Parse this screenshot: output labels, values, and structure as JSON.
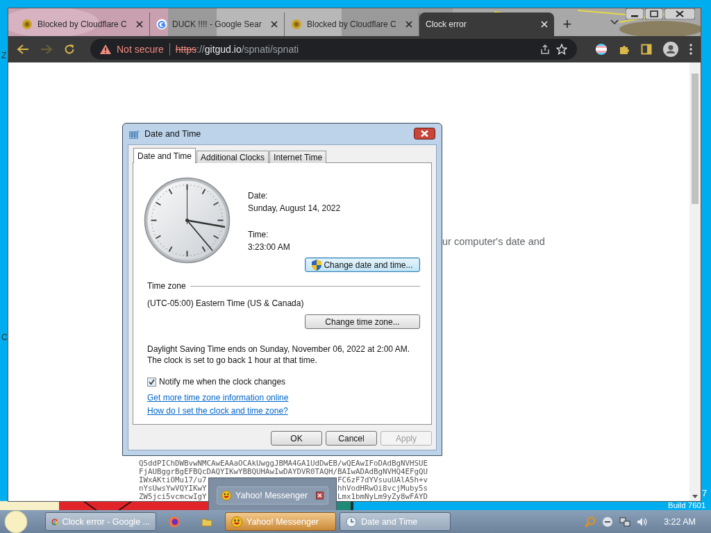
{
  "desktop": {
    "labels": [
      {
        "text": "Z"
      },
      {
        "text": "C"
      },
      {
        "text": "7"
      },
      {
        "text": "Build 7601"
      }
    ]
  },
  "browser": {
    "tabs": [
      {
        "title": "Blocked by Cloudflare C",
        "kind": "site",
        "selected": false
      },
      {
        "title": "DUCK !!!! - Google Sear",
        "kind": "search",
        "selected": false
      },
      {
        "title": "Blocked by Cloudflare C",
        "kind": "site",
        "selected": false
      },
      {
        "title": "Clock error",
        "kind": "blank",
        "selected": true
      }
    ],
    "new_tab": "+",
    "security_warning": "Not secure",
    "url": {
      "scheme": "https",
      "separator": "://",
      "host": "gitgud.io",
      "path": "/spnati/spnati"
    },
    "page": {
      "message": "ur computer's date and",
      "code_lines": [
        {
          "parts": [
            "Q5ddPIChDWBvwNMCAwEAAaOCAkUwggJBMA4GA1UdDwEB/wQEAwIFoDAdBgNVHSUE"
          ]
        },
        {
          "parts": [
            "FjAUBggrBgEFBQcDAQYIKwYBBQUHAwIwDAYDVR0TAQH/BAIwADAdBgNVHQ4EFgQU"
          ]
        },
        {
          "parts": [
            "IWxAKtiOMu17/u7",
            "FC6zF7dYVsuuUAlA5h+v"
          ]
        },
        {
          "parts": [
            "nYsUwsYwVQYIKwY",
            "hhVodHRwOi8vcjMuby5s"
          ]
        },
        {
          "parts": [
            "ZW5jci5vcmcwIgY",
            "Lmx1bmNyLm9yZy8wFAYD"
          ]
        }
      ]
    }
  },
  "dialog": {
    "title": "Date and Time",
    "tabs": [
      {
        "label": "Date and Time",
        "selected": true
      },
      {
        "label": "Additional Clocks",
        "selected": false
      },
      {
        "label": "Internet Time",
        "selected": false
      }
    ],
    "date_label": "Date:",
    "date": "Sunday, August 14, 2022",
    "time_label": "Time:",
    "time": "3:23:00 AM",
    "change_datetime_button": "Change date and time...",
    "time_zone_heading": "Time zone",
    "time_zone": "(UTC-05:00) Eastern Time (US & Canada)",
    "change_zone_button": "Change time zone...",
    "dst_note": "Daylight Saving Time ends on Sunday, November 06, 2022 at 2:00 AM. The clock is set to go back 1 hour at that time.",
    "notify": {
      "label": "Notify me when the clock changes",
      "checked": true
    },
    "links": [
      "Get more time zone information online",
      "How do I set the clock and time zone?"
    ],
    "buttons": [
      {
        "label": "OK",
        "disabled": false
      },
      {
        "label": "Cancel",
        "disabled": false
      },
      {
        "label": "Apply",
        "disabled": true
      }
    ]
  },
  "notification": {
    "title": "Yahoo! Messenger"
  },
  "taskbar": {
    "items": [
      {
        "kind": "chrome",
        "label": "Clock error - Google ...",
        "selected": false
      },
      {
        "kind": "firefox",
        "selected": false
      },
      {
        "kind": "folder",
        "selected": false
      },
      {
        "kind": "messenger",
        "label": "Yahoo! Messenger",
        "selected": true
      },
      {
        "kind": "clock",
        "label": "Date and Time",
        "selected": false
      }
    ],
    "clock": "3:22 AM"
  }
}
